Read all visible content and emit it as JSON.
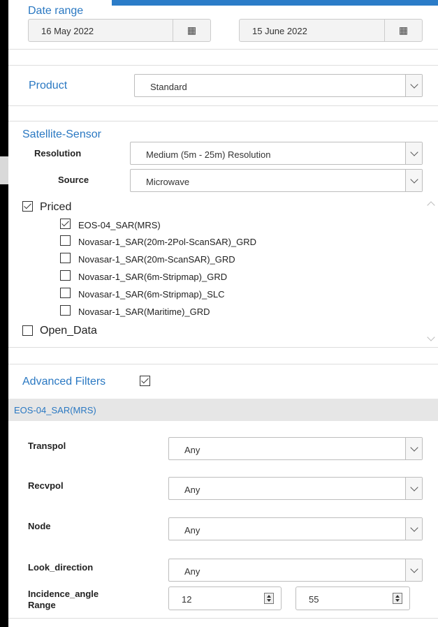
{
  "date_range": {
    "title": "Date range",
    "start": "16 May 2022",
    "end": "15 June 2022",
    "icon": "calendar-icon"
  },
  "product": {
    "label": "Product",
    "value": "Standard"
  },
  "satellite_sensor": {
    "title": "Satellite-Sensor",
    "resolution_label": "Resolution",
    "resolution_value": "Medium (5m - 25m) Resolution",
    "source_label": "Source",
    "source_value": "Microwave",
    "groups": [
      {
        "label": "Priced",
        "checked": true,
        "items": [
          {
            "label": "EOS-04_SAR(MRS)",
            "checked": true
          },
          {
            "label": "Novasar-1_SAR(20m-2Pol-ScanSAR)_GRD",
            "checked": false
          },
          {
            "label": "Novasar-1_SAR(20m-ScanSAR)_GRD",
            "checked": false
          },
          {
            "label": "Novasar-1_SAR(6m-Stripmap)_GRD",
            "checked": false
          },
          {
            "label": "Novasar-1_SAR(6m-Stripmap)_SLC",
            "checked": false
          },
          {
            "label": "Novasar-1_SAR(Maritime)_GRD",
            "checked": false
          }
        ]
      },
      {
        "label": "Open_Data",
        "checked": false
      }
    ]
  },
  "advanced_filters": {
    "title": "Advanced Filters",
    "enabled": true,
    "sensor": "EOS-04_SAR(MRS)",
    "filters": [
      {
        "label": "Transpol",
        "value": "Any"
      },
      {
        "label": "Recvpol",
        "value": "Any"
      },
      {
        "label": "Node",
        "value": "Any"
      },
      {
        "label": "Look_direction",
        "value": "Any"
      }
    ],
    "incidence": {
      "label_line1": "Incidence_angle",
      "label_line2": "Range",
      "min": "12",
      "max": "55"
    }
  },
  "colors": {
    "accent": "#2a78c2",
    "band": "#e6e6e6"
  }
}
